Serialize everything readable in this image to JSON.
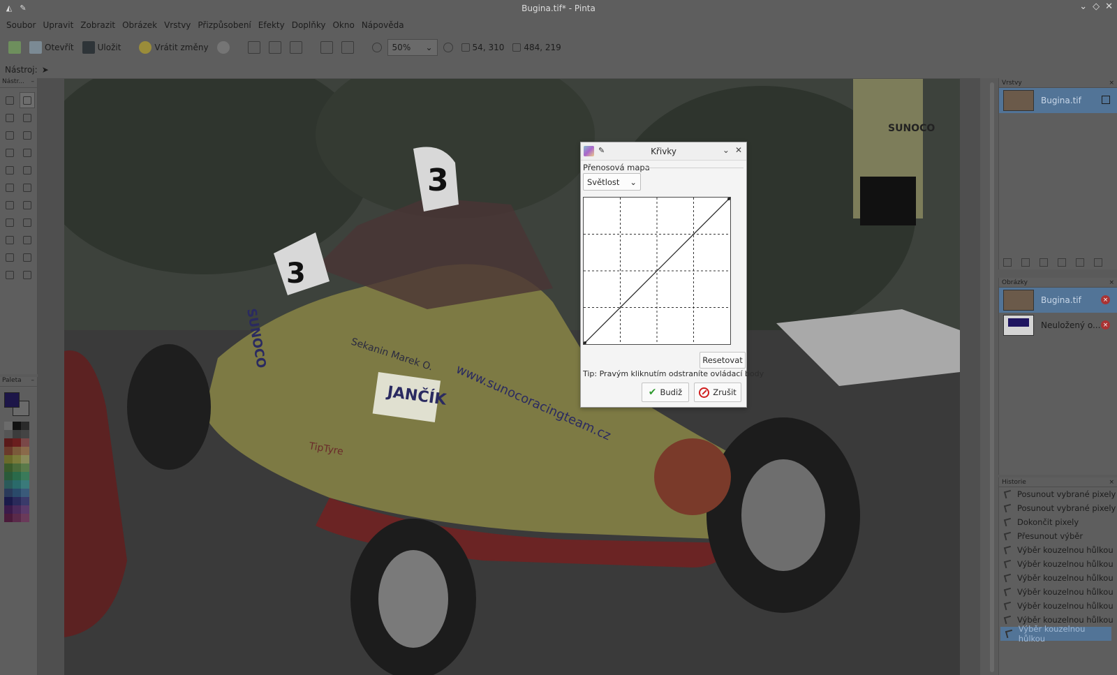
{
  "window": {
    "title": "Bugina.tif* - Pinta"
  },
  "menu": [
    "Soubor",
    "Upravit",
    "Zobrazit",
    "Obrázek",
    "Vrstvy",
    "Přizpůsobení",
    "Efekty",
    "Doplňky",
    "Okno",
    "Nápověda"
  ],
  "toolbar": {
    "open": "Otevřít",
    "save": "Uložit",
    "undo": "Vrátit změny",
    "zoom": "50%",
    "cursor_pos": "54, 310",
    "selection_size": "484, 219"
  },
  "toolrow": {
    "label": "Nástroj:"
  },
  "tools_panel": {
    "title": "Nástr..."
  },
  "palette_panel": {
    "title": "Paleta",
    "primary": "#1d1648",
    "secondary": "#6a6a6a"
  },
  "layers_panel": {
    "title": "Vrstvy",
    "layers": [
      {
        "name": "Bugina.tif"
      }
    ]
  },
  "images_panel": {
    "title": "Obrázky",
    "images": [
      {
        "name": "Bugina.tif"
      },
      {
        "name": "Neuložený o..."
      }
    ]
  },
  "history_panel": {
    "title": "Historie",
    "items": [
      "Posunout vybrané pixely",
      "Posunout vybrané pixely",
      "Dokončit pixely",
      "Přesunout výběr",
      "Výběr kouzelnou hůlkou",
      "Výběr kouzelnou hůlkou",
      "Výběr kouzelnou hůlkou",
      "Výběr kouzelnou hůlkou",
      "Výběr kouzelnou hůlkou",
      "Výběr kouzelnou hůlkou",
      "Výběr kouzelnou hůlkou"
    ]
  },
  "dialog": {
    "title": "Křivky",
    "section": "Přenosová mapa",
    "mode": "Světlost",
    "reset": "Resetovat",
    "tip": "Tip: Pravým kliknutím odstraníte ovládací body",
    "ok": "Budiž",
    "cancel": "Zrušit"
  },
  "canvas": {
    "numbers": [
      "3",
      "3"
    ],
    "texts": [
      "SUNOCO",
      "Sekanin Marek O.",
      "JANČÍK",
      "www.sunocoracingteam.cz",
      "TipTyre",
      "SUNOCO"
    ]
  }
}
